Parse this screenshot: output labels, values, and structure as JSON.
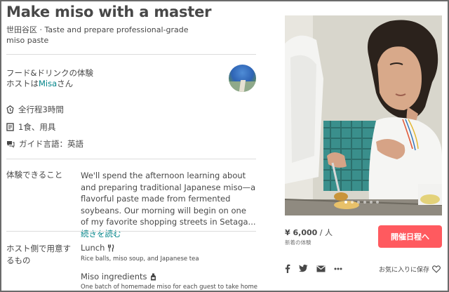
{
  "listing": {
    "title": "Make miso with a master",
    "subtitle": "世田谷区 · Taste and prepare professional-grade miso paste"
  },
  "host": {
    "experience_type": "フード&ドリンクの体験",
    "host_prefix": "ホストは",
    "host_name": "Misa",
    "host_suffix": "さん"
  },
  "details": {
    "duration": "全行程3時間",
    "includes": "1食、用具",
    "language": "ガイド言語：英語"
  },
  "experience": {
    "label": "体験できること",
    "description": "We'll spend the afternoon learning about and preparing traditional Japanese miso—a flavorful paste made from fermented soybeans. Our morning will begin on one of my favorite shopping streets in Setaga...",
    "read_more": "続きを読む"
  },
  "provides": {
    "label": "ホスト側で用意するもの",
    "items": [
      {
        "title": "Lunch",
        "icon": "utensils-icon",
        "desc": "Rice balls, miso soup, and Japanese tea"
      },
      {
        "title": "Miso ingredients",
        "icon": "bottle-icon",
        "desc": "One batch of homemade miso for each guest to take home"
      }
    ]
  },
  "photo": {
    "slide_count": 6,
    "active_slide": 1
  },
  "booking": {
    "price": "¥ 6,000",
    "per": " / 人",
    "price_note": "新着の体験",
    "button": "開催日程へ"
  },
  "share": {
    "icons": [
      "facebook-icon",
      "twitter-icon",
      "email-icon",
      "more-icon"
    ],
    "wishlist": "お気に入りに保存"
  },
  "colors": {
    "accent": "#ff5a5f",
    "link": "#008489",
    "text": "#484848"
  }
}
